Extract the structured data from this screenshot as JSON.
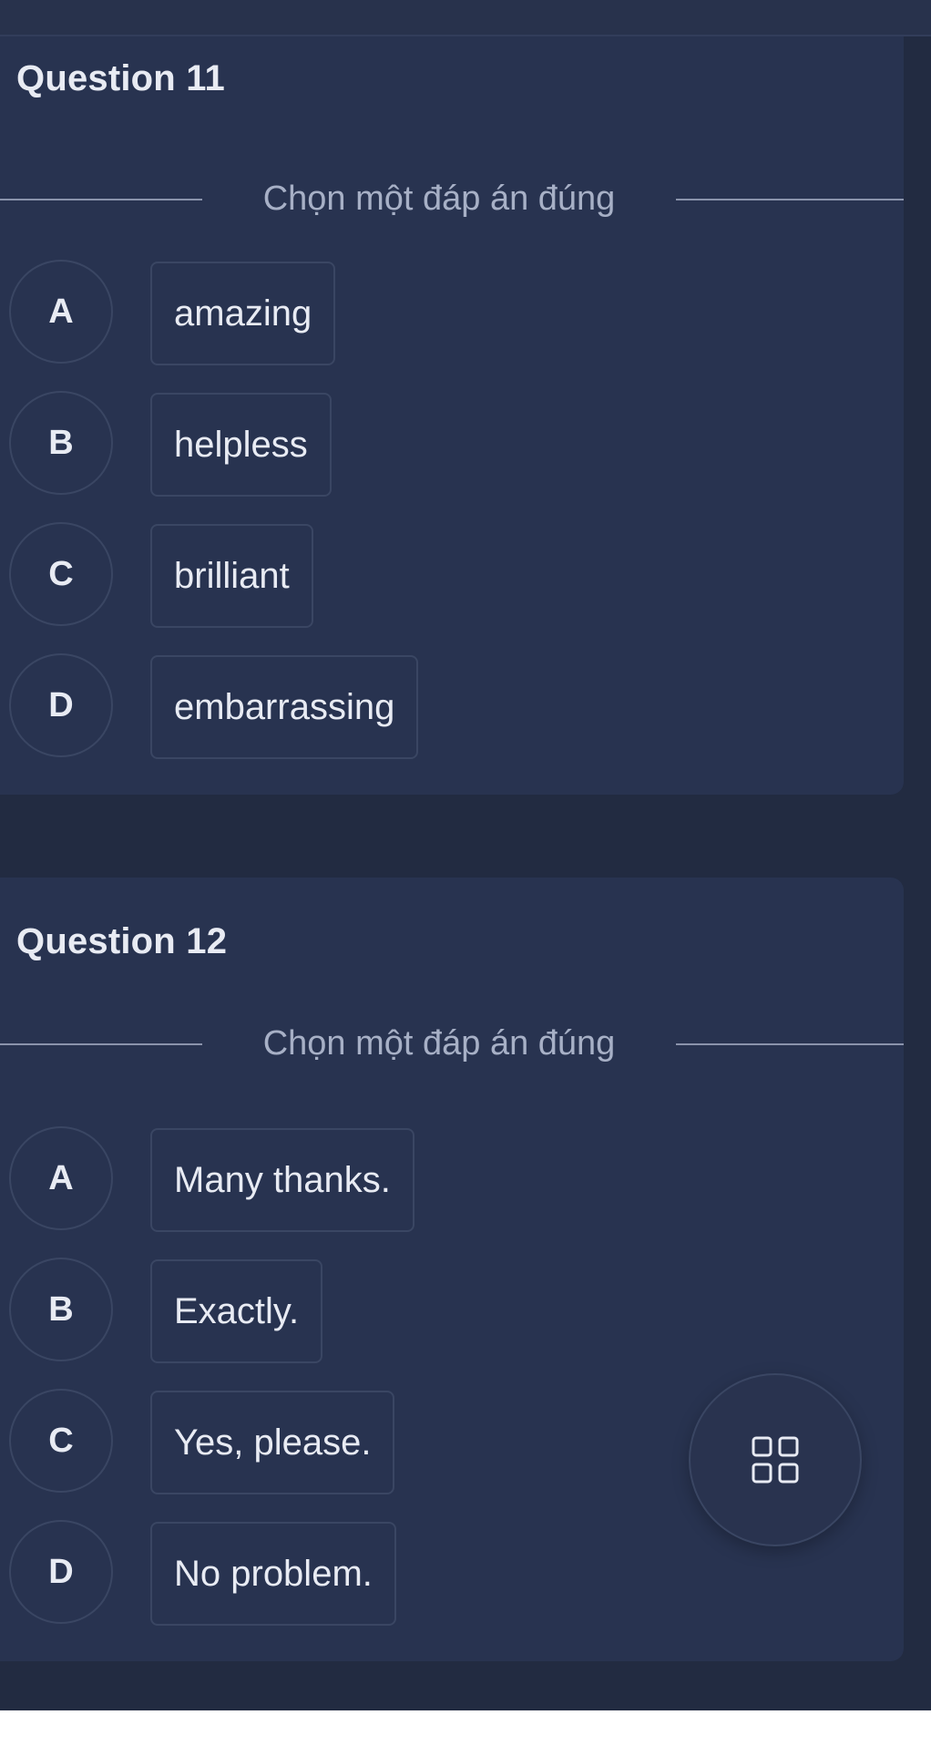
{
  "questions": [
    {
      "title": "Question 11",
      "instruction": "Chọn một đáp án đúng",
      "options": [
        {
          "letter": "A",
          "text": "amazing"
        },
        {
          "letter": "B",
          "text": "helpless"
        },
        {
          "letter": "C",
          "text": "brilliant"
        },
        {
          "letter": "D",
          "text": "embarrassing"
        }
      ]
    },
    {
      "title": "Question 12",
      "instruction": "Chọn một đáp án đúng",
      "options": [
        {
          "letter": "A",
          "text": "Many thanks."
        },
        {
          "letter": "B",
          "text": "Exactly."
        },
        {
          "letter": "C",
          "text": "Yes, please."
        },
        {
          "letter": "D",
          "text": "No problem."
        }
      ]
    }
  ],
  "fab": {
    "icon": "grid-icon"
  },
  "colors": {
    "background": "#222b41",
    "card": "#283350",
    "border": "#3a4663",
    "text": "#e8ebf3",
    "muted_text": "#a7b0c6"
  }
}
